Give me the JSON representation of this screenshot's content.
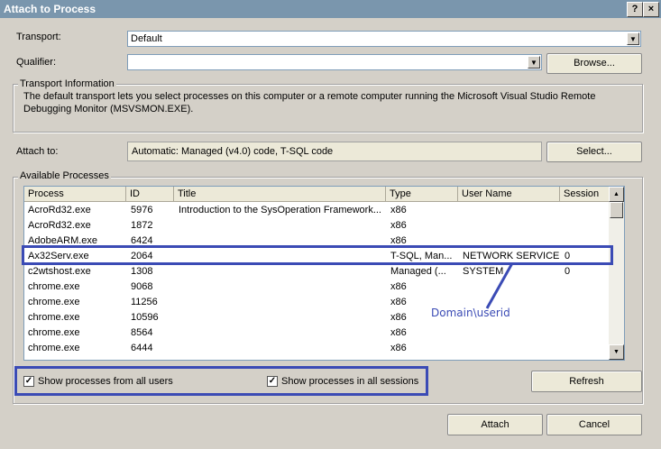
{
  "window": {
    "title": "Attach to Process",
    "help_glyph": "?",
    "close_glyph": "×"
  },
  "transport": {
    "label": "Transport:",
    "value": "Default"
  },
  "qualifier": {
    "label": "Qualifier:",
    "value": "",
    "browse_label": "Browse..."
  },
  "transport_info": {
    "group_label": "Transport Information",
    "text_line1": "The default transport lets you select processes on this computer or a remote computer running the Microsoft Visual Studio Remote",
    "text_line2": "Debugging Monitor (MSVSMON.EXE)."
  },
  "attach_to": {
    "label": "Attach to:",
    "value": "Automatic: Managed (v4.0) code, T-SQL code",
    "select_label": "Select..."
  },
  "available": {
    "group_label": "Available Processes",
    "columns": [
      "Process",
      "ID",
      "Title",
      "Type",
      "User Name",
      "Session"
    ],
    "rows": [
      {
        "process": "AcroRd32.exe",
        "id": "5976",
        "title": "Introduction to the SysOperation Framework...",
        "type": "x86",
        "user": "",
        "session": ""
      },
      {
        "process": "AcroRd32.exe",
        "id": "1872",
        "title": "",
        "type": "x86",
        "user": "",
        "session": ""
      },
      {
        "process": "AdobeARM.exe",
        "id": "6424",
        "title": "",
        "type": "x86",
        "user": "",
        "session": ""
      },
      {
        "process": "Ax32Serv.exe",
        "id": "2064",
        "title": "",
        "type": "T-SQL, Man...",
        "user": "NETWORK SERVICE",
        "session": "0"
      },
      {
        "process": "c2wtshost.exe",
        "id": "1308",
        "title": "",
        "type": "Managed (...",
        "user": "SYSTEM",
        "session": "0"
      },
      {
        "process": "chrome.exe",
        "id": "9068",
        "title": "",
        "type": "x86",
        "user": "",
        "session": ""
      },
      {
        "process": "chrome.exe",
        "id": "11256",
        "title": "",
        "type": "x86",
        "user": "",
        "session": ""
      },
      {
        "process": "chrome.exe",
        "id": "10596",
        "title": "",
        "type": "x86",
        "user": "",
        "session": ""
      },
      {
        "process": "chrome.exe",
        "id": "8564",
        "title": "",
        "type": "x86",
        "user": "",
        "session": ""
      },
      {
        "process": "chrome.exe",
        "id": "6444",
        "title": "",
        "type": "x86",
        "user": "",
        "session": ""
      }
    ],
    "show_all_users": "Show processes from all users",
    "show_all_sessions": "Show processes in all sessions",
    "refresh_label": "Refresh"
  },
  "annotation": {
    "text": "Domain\\userid",
    "color": "#3b4bb5"
  },
  "footer": {
    "attach_label": "Attach",
    "cancel_label": "Cancel"
  }
}
